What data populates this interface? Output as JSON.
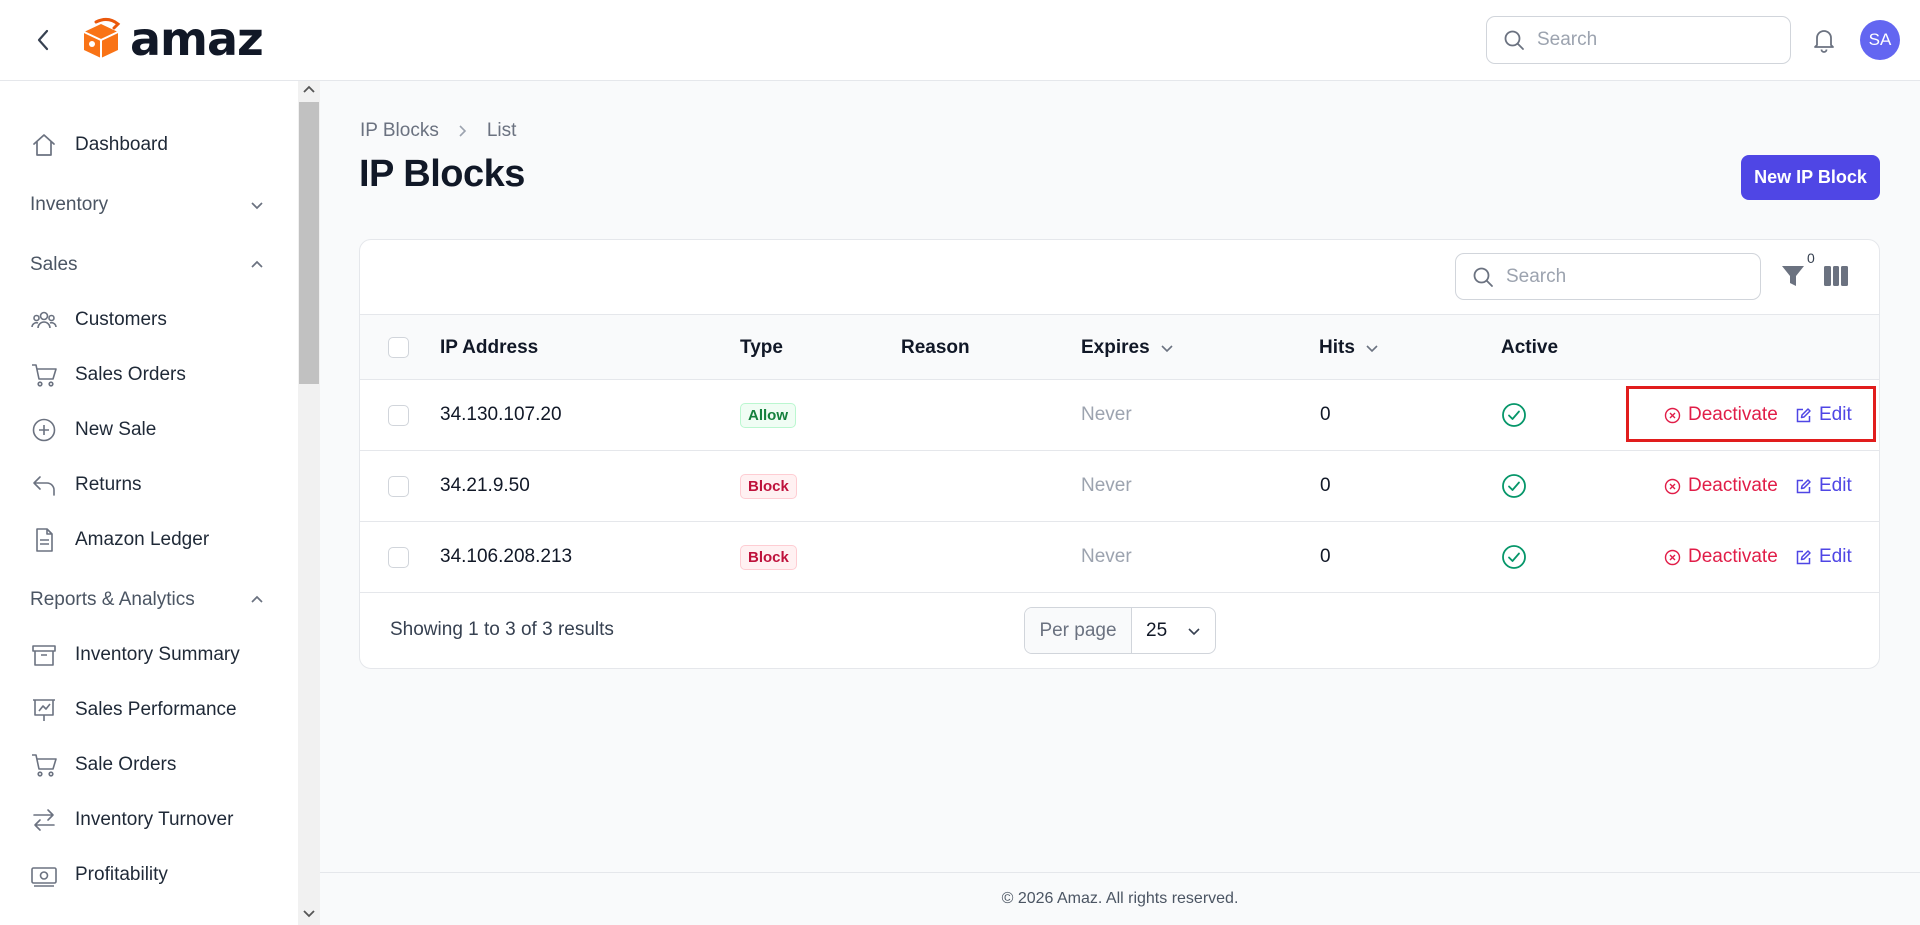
{
  "header": {
    "logo_text": "amaz",
    "search_placeholder": "Search",
    "avatar_initials": "SA"
  },
  "sidebar": {
    "items": [
      {
        "label": "Dashboard",
        "icon": "home-icon"
      },
      {
        "group": "Inventory",
        "expanded": false
      },
      {
        "group": "Sales",
        "expanded": true
      },
      {
        "label": "Customers",
        "icon": "users-icon"
      },
      {
        "label": "Sales Orders",
        "icon": "cart-icon"
      },
      {
        "label": "New Sale",
        "icon": "plus-circle-icon"
      },
      {
        "label": "Returns",
        "icon": "return-arrow-icon"
      },
      {
        "label": "Amazon Ledger",
        "icon": "document-icon"
      },
      {
        "group": "Reports & Analytics",
        "expanded": true
      },
      {
        "label": "Inventory Summary",
        "icon": "archive-box-icon"
      },
      {
        "label": "Sales Performance",
        "icon": "chart-icon"
      },
      {
        "label": "Sale Orders",
        "icon": "cart-icon"
      },
      {
        "label": "Inventory Turnover",
        "icon": "swap-arrows-icon"
      },
      {
        "label": "Profitability",
        "icon": "banknote-icon"
      }
    ]
  },
  "breadcrumb": [
    "IP Blocks",
    "List"
  ],
  "page": {
    "title": "IP Blocks",
    "new_button": "New IP Block"
  },
  "table": {
    "search_placeholder": "Search",
    "filter_count": "0",
    "columns": [
      "IP Address",
      "Type",
      "Reason",
      "Expires",
      "Hits",
      "Active"
    ],
    "rows": [
      {
        "ip": "34.130.107.20",
        "type": "Allow",
        "reason": "",
        "expires": "Never",
        "hits": "0",
        "active": true
      },
      {
        "ip": "34.21.9.50",
        "type": "Block",
        "reason": "",
        "expires": "Never",
        "hits": "0",
        "active": true
      },
      {
        "ip": "34.106.208.213",
        "type": "Block",
        "reason": "",
        "expires": "Never",
        "hits": "0",
        "active": true
      }
    ],
    "actions": {
      "deactivate": "Deactivate",
      "edit": "Edit"
    },
    "showing": "Showing 1 to 3 of 3 results",
    "per_page_label": "Per page",
    "per_page_value": "25"
  },
  "footer": "© 2026 Amaz. All rights reserved.",
  "colors": {
    "accent": "#4f46e5",
    "danger": "#e11d48",
    "success": "#059669",
    "highlight": "#e11d1d"
  }
}
